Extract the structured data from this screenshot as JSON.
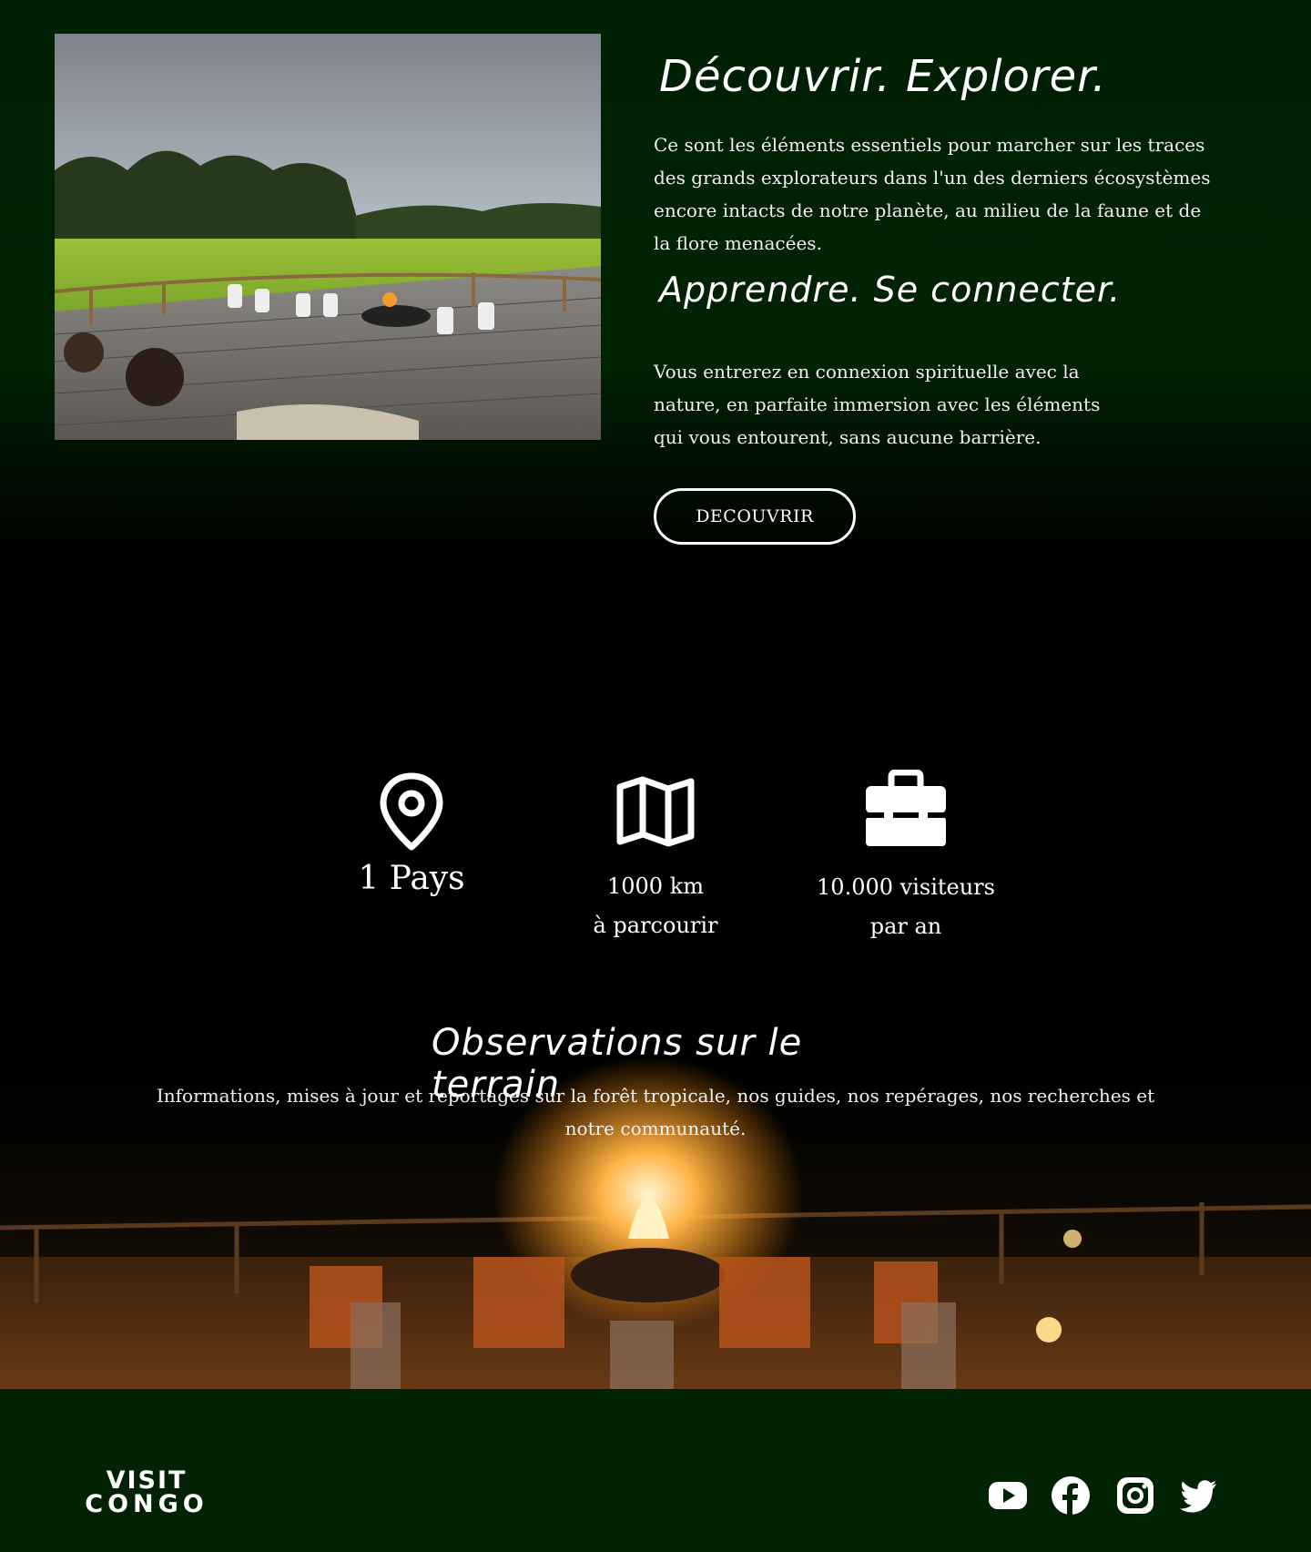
{
  "intro": {
    "heading_1": "Découvrir. Explorer.",
    "paragraph_1": "Ce sont les éléments essentiels pour marcher sur les traces des grands explorateurs dans l'un des derniers écosystèmes encore intacts de notre planète, au milieu de la faune et de la flore menacées.",
    "heading_2": "Apprendre. Se connecter.",
    "paragraph_2": " Vous entrerez en connexion spirituelle avec la nature, en parfaite immersion avec les éléments qui vous entourent, sans aucune barrière.",
    "button_label": "DECOUVRIR"
  },
  "stats": [
    {
      "icon": "map-pin-icon",
      "line1": "1 Pays",
      "line2": ""
    },
    {
      "icon": "folded-map-icon",
      "line1": "1000 km",
      "line2": "à parcourir"
    },
    {
      "icon": "briefcase-icon",
      "line1": "10.000 visiteurs",
      "line2": "par an"
    }
  ],
  "observations": {
    "title": "Observations sur le terrain",
    "text": "Informations, mises à jour et reportages sur la forêt tropicale, nos guides, nos repérages, nos recherches et notre communauté."
  },
  "footer": {
    "logo_line1": "VISIT",
    "logo_line2": "CONGO",
    "social": [
      "youtube-icon",
      "facebook-icon",
      "instagram-icon",
      "twitter-icon"
    ]
  },
  "colors": {
    "background_green": "#012303",
    "text": "#ffffff",
    "black": "#000000"
  }
}
